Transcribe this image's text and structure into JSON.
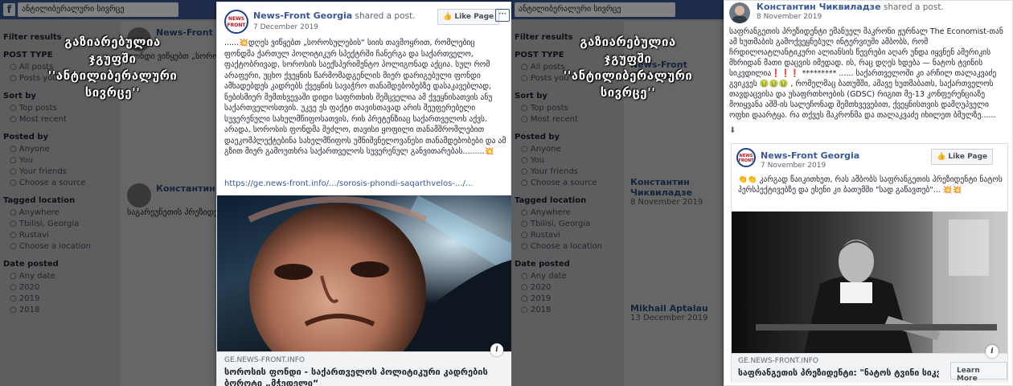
{
  "left_panel": {
    "search_query": "ანტილიბერალური სივრცე",
    "overlay_text": [
      "გაზიარებულია",
      "ჯგუფში",
      "''ანტილიბერალური",
      "სივრცე''"
    ],
    "sidebar": [
      {
        "heading": "Filter results",
        "items": []
      },
      {
        "heading": "POST TYPE",
        "items": [
          "All posts",
          "Posts you've seen"
        ]
      },
      {
        "heading": "Sort by",
        "items": [
          "Top posts",
          "Most recent"
        ]
      },
      {
        "heading": "Posted by",
        "items": [
          "Anyone",
          "You",
          "Your friends",
          "Choose a source"
        ]
      },
      {
        "heading": "Tagged location",
        "items": [
          "Anywhere",
          "Tbilisi, Georgia",
          "Rustavi",
          "Choose a location"
        ]
      },
      {
        "heading": "Date posted",
        "items": [
          "Any date",
          "2020",
          "2019",
          "2018"
        ]
      }
    ],
    "feed_posts": [
      {
        "name": "News-Front Georgia",
        "text": "ფონდი ვიწყებთ „სოროსულების“ სიის თავმოყრით..."
      },
      {
        "name": "Константин Чиквиладзе",
        "text": "საგარეუნეთის პრეზიდენტი ემანუელ მაკრონი ჟურნალ The Economist-ის..."
      }
    ],
    "card": {
      "page_name": "News-Front Georgia",
      "action": "shared a post.",
      "date": "7 December 2019",
      "like_label": "Like Page",
      "more_label": "···",
      "logo_text": "NEWS FRONT",
      "post_text": "......💥დღეს ვიწყებთ „სოროსულების“ სიის თავმოყრით, რომლებიც ფონდმა ქართულ პოლიტიკურ სპექტრში ჩანერგა და საქართველო, ფაქტობრივად, სოროსის საექსპერიმენტო პოლიგონად აქცია. სულ რომ არაფერი, უცხო ქვეყნის წარმომადგენლის მიერ დარიგებული ფონდი ამხადებდეს კადრებს ქვეყნის სავაჭრო თანამდებობებზე დასაკავებლად, ნებისმიერ მემთხვევაში დიდი საფრთხის შემცველია ამ ქვეყნისათვის ანუ საქართველოსთვის. უკვე ეს ფაქტი თავისთავად არის შეუფერებელი სუვერენული სახელმწიფოსათვის, რის პრეტენზიაც საქართველოს აქვს. არადა, სოროსის ფონდმა შეძლო, თავისი ყოფილი თანამშრომლებით დაეკომპლექტებინა სახელმწიფოს უმნიშვნელოვანესი თანამდებობები და ამ გზით მიერ გამოუთხრა საქართველოს სუვერენულ განვითარებას.........💥",
      "link_url": "https://ge.news-front.info/.../sorosis-phondi-saqarthvelos-.../...",
      "domain": "GE.NEWS-FRONT.INFO",
      "link_title": "სოროსის ფონდი - საქართველოს პოლიტიკური კადრების ბოროტი „მჭედელი“",
      "info_label": "i"
    }
  },
  "right_panel": {
    "search_query": "ანტილიბერალური სივრცე",
    "overlay_text": [
      "გაზიარებულია",
      "ჯგუფში",
      "''ანტილიბერალური",
      "სივრცე''"
    ],
    "feed_posts": [
      {
        "name": "Константин Чиквиладзе",
        "date": "8 November 2019"
      },
      {
        "name": "News-Front Georgia's",
        "date": "7 November 2019"
      },
      {
        "name": "Mikhail Aptalau",
        "date": "13 December 2019"
      }
    ],
    "card": {
      "author": "Константин Чиквиладзе",
      "action": "shared a post.",
      "date": "8 November 2019",
      "post_text": "საფრანგეთის პრეზიდენტი ემანუელ მაკრონი ჟურნალ The Economist-თან ამ ხუთმაბის გამოქვეყნებულ ინტერვიუში ამბობს, რომ ჩრდილოატლანტიკური ალიანსის წევრები აღარ უნდა იყვნენ ამერიკის მხრიდან მათი დაცვის იმედად. ის, რაც დღეს ხდება — ნატოს ტვინის სიკვდილია❗❗❗ ********* ...... საქართველოში კი არჩილ თალაკვაძე გვიკვეს 🤢🤢🤢 , რომელმაც ბათუმში, ამავე ხუთმაბათს, საქართველოს თავდაცვისა და უსაფრთხოების (GDSC) რიგით მე-13 კონფერენციაზე მოიყვანა აშშ-ის სალეჩონად შემთხვევებით, ქვეყნისთვის დამღუპველი ოფხი დაარტყა. რა თქვეს მაკრონმა და თალაკვაძე იხილეთ ბმულზე......",
      "more_icon_label": "⬇",
      "shared": {
        "page_name": "News-Front Georgia",
        "date": "7 November 2019",
        "like_label": "Like Page",
        "logo_text": "NEWS FRONT",
        "text": "👏👏 კარგად წაიკითხეთ, რას ამბობს საფრანგეთის პრეზიდენტი ნატოს პერსპექტივებზე და ესენი კი ბათუმში \"სად გაწავთებ\"... 💥💥",
        "domain": "GE.NEWS-FRONT.INFO",
        "link_title": "საფრანგეთის პრეზიდენტი: \"ნატოს ტვინი სიკვდილის პირზეა\"",
        "learn_more": "Learn More",
        "info_label": "i"
      }
    }
  }
}
